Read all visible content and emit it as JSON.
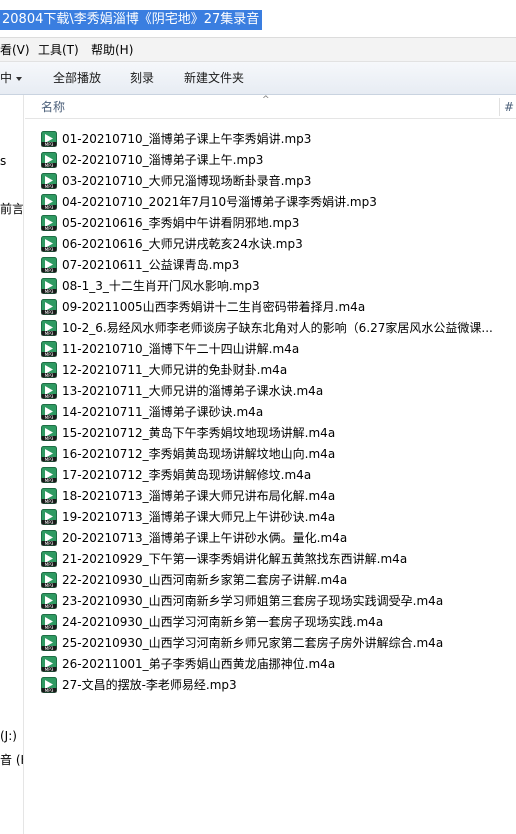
{
  "address": {
    "path": "20804下载\\李秀娟淄博《阴宅地》27集录音"
  },
  "menu": [
    "看(V)",
    "工具(T)",
    "帮助(H)"
  ],
  "toolbar": {
    "cut": "中",
    "playall": "全部播放",
    "burn": "刻录",
    "newfolder": "新建文件夹"
  },
  "nav": {
    "s": "s",
    "qianyan": "前言",
    "drive_j": "(J:)",
    "drive_k": "音 (K"
  },
  "columns": {
    "name": "名称",
    "next": "#"
  },
  "files": [
    "01-20210710_淄博弟子课上午李秀娟讲.mp3",
    "02-20210710_淄博弟子课上午.mp3",
    "03-20210710_大师兄淄博现场断卦录音.mp3",
    "04-20210710_2021年7月10号淄博弟子课李秀娟讲.mp3",
    "05-20210616_李秀娟中午讲看阴邪地.mp3",
    "06-20210616_大师兄讲戌乾亥24水诀.mp3",
    "07-20210611_公益课青岛.mp3",
    "08-1_3_十二生肖开门风水影响.mp3",
    "09-20211005山西李秀娟讲十二生肖密码带着择月.m4a",
    "10-2_6.易经风水师李老师谈房子缺东北角对人的影响（6.27家居风水公益微课...",
    "11-20210710_淄博下午二十四山讲解.m4a",
    "12-20210711_大师兄讲的免卦财卦.m4a",
    "13-20210711_大师兄讲的淄博弟子课水诀.m4a",
    "14-20210711_淄博弟子课砂诀.m4a",
    "15-20210712_黄岛下午李秀娟坟地现场讲解.m4a",
    "16-20210712_李秀娟黄岛现场讲解坟地山向.m4a",
    "17-20210712_李秀娟黄岛现场讲解修坟.m4a",
    "18-20210713_淄博弟子课大师兄讲布局化解.m4a",
    "19-20210713_淄博弟子课大师兄上午讲砂诀.m4a",
    "20-20210713_淄博弟子课上午讲砂水俩。量化.m4a",
    "21-20210929_下午第一课李秀娟讲化解五黄煞找东西讲解.m4a",
    "22-20210930_山西河南新乡家第二套房子讲解.m4a",
    "23-20210930_山西河南新乡学习师姐第三套房子现场实践调受孕.m4a",
    "24-20210930_山西学习河南新乡第一套房子现场实践.m4a",
    "25-20210930_山西学习河南新乡师兄家第二套房子房外讲解综合.m4a",
    "26-20211001_弟子李秀娟山西黄龙庙挪神位.m4a",
    "27-文昌的摆放-李老师易经.mp3"
  ],
  "icon": {
    "label": "MP3",
    "name": "audio-file-icon"
  }
}
